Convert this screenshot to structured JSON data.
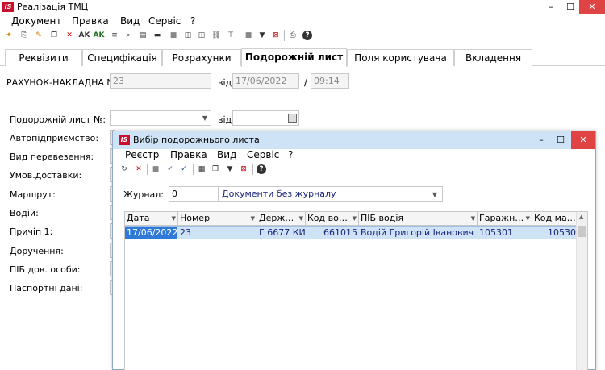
{
  "window": {
    "logo": "IS",
    "title": "Реалізація ТМЦ",
    "minimize": "–",
    "maximize": "☐",
    "close": "✕"
  },
  "menu": [
    "Документ",
    "Правка",
    "Вид",
    "Сервіс",
    "?"
  ],
  "tabs": [
    "Реквізити",
    "Специфікація",
    "Розрахунки",
    "Подорожній лист",
    "Поля користувача",
    "Вкладення"
  ],
  "active_tab": "Подорожній лист",
  "invoice": {
    "label": "РАХУНОК-НАКЛАДНА №:",
    "number": "23",
    "date_label": "від:",
    "date": "17/06/2022",
    "separator": "/",
    "time": "09:14"
  },
  "waybill": {
    "label": "Подорожній лист №:",
    "value": "",
    "date_label": "від:",
    "date": ""
  },
  "side_labels": [
    "Автопідприємство:",
    "Вид перевезення:",
    "Умов.доставки:",
    "Маршрут:",
    "Водій:",
    "Причіп 1:",
    "Доручення:",
    "ПІБ дов. особи:",
    "Паспортні дані:"
  ],
  "dialog": {
    "logo": "IS",
    "title": "Вибір подорожнього листа",
    "minimize": "–",
    "maximize": "☐",
    "close": "✕",
    "menu": [
      "Реєстр",
      "Правка",
      "Вид",
      "Сервіс",
      "?"
    ],
    "journal_label": "Журнал:",
    "journal_code": "0",
    "journal_name": "Документи без журналу",
    "columns": [
      "Дата",
      "Номер",
      "Держ…",
      "Код во…",
      "ПІБ водія",
      "Гаражн…",
      "Код ма…"
    ],
    "rows": [
      [
        "17/06/2022",
        "23",
        "Г 6677 КИ",
        "661015",
        "Водій Григорій Іванович",
        "105301",
        "10530"
      ]
    ]
  },
  "icons": {
    "toolbar": [
      "new-doc-icon",
      "copy-doc-icon",
      "edit-doc-icon",
      "copy-icon",
      "delete-icon",
      "ak-icon",
      "ak-check-icon",
      "list-icon",
      "print-preview-icon",
      "calc-icon",
      "stop-icon",
      "grid-icon",
      "grid2-icon",
      "link-icon",
      "tree-icon",
      "rect-icon",
      "filter-icon",
      "clear-filter-icon",
      "print-icon",
      "help-icon"
    ],
    "dialog_toolbar": [
      "refresh-icon",
      "delete-icon",
      "stop-icon",
      "check-icon",
      "check-all-icon",
      "table-icon",
      "copy-icon",
      "filter-icon",
      "clear-filter-icon",
      "help-icon"
    ]
  },
  "colors": {
    "accent": "#2f7ad9",
    "dialog_title_bg": "#cfe3f6",
    "close_btn": "#e04343",
    "logo_red": "#c8102e"
  }
}
